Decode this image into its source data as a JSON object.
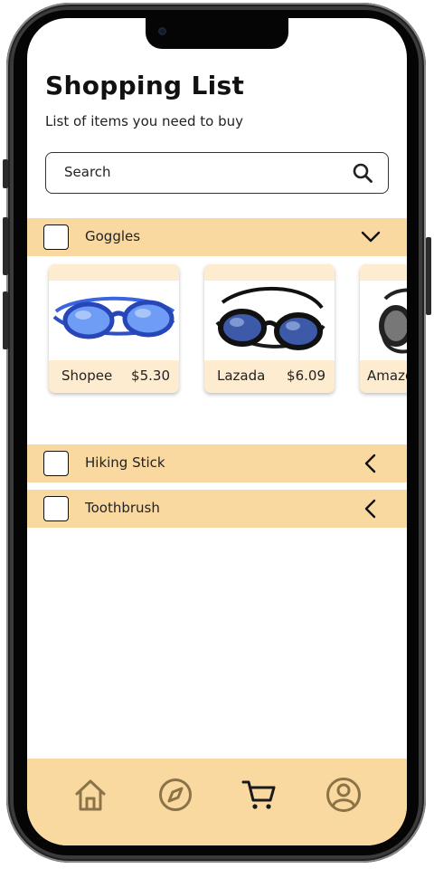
{
  "header": {
    "title": "Shopping List",
    "subtitle": "List of items you need to buy"
  },
  "search": {
    "placeholder": "Search",
    "icon": "search-icon"
  },
  "items": [
    {
      "label": "Goggles",
      "checked": false,
      "expanded": true,
      "offers": [
        {
          "store": "Shopee",
          "price": "$5.30",
          "image": "blue-goggles"
        },
        {
          "store": "Lazada",
          "price": "$6.09",
          "image": "black-goggles"
        },
        {
          "store": "Amazon",
          "price": "",
          "image": "black-goggles"
        }
      ]
    },
    {
      "label": "Hiking Stick",
      "checked": false,
      "expanded": false
    },
    {
      "label": "Toothbrush",
      "checked": false,
      "expanded": false
    }
  ],
  "tabbar": {
    "tabs": [
      "home-icon",
      "compass-icon",
      "cart-icon",
      "profile-icon"
    ],
    "active": "cart-icon"
  },
  "colors": {
    "accent": "#fad9a1",
    "card": "#fdecd0",
    "icon_inactive": "#8a7346",
    "icon_active": "#1a1a1a"
  }
}
